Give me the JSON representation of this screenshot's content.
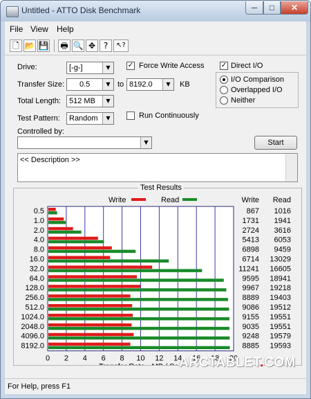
{
  "window": {
    "title": "Untitled - ATTO Disk Benchmark",
    "min_glyph": "─",
    "max_glyph": "□",
    "close_glyph": "✕"
  },
  "menu": {
    "items": [
      "File",
      "View",
      "Help"
    ]
  },
  "toolbar": {
    "icons": [
      {
        "name": "new-file-icon",
        "glyph": "🗋"
      },
      {
        "name": "open-folder-icon",
        "glyph": "📂"
      },
      {
        "name": "save-icon",
        "glyph": "💾"
      },
      {
        "name": "print-icon",
        "glyph": "🖶"
      },
      {
        "name": "print-preview-icon",
        "glyph": "🔍"
      },
      {
        "name": "move-icon",
        "glyph": "✥"
      },
      {
        "name": "help-icon",
        "glyph": "?"
      },
      {
        "name": "context-help-icon",
        "glyph": "↖?"
      }
    ]
  },
  "form": {
    "drive_label": "Drive:",
    "drive_value": "[-g-]",
    "transfer_label": "Transfer Size:",
    "transfer_from": "0.5",
    "to_label": "to",
    "transfer_to": "8192.0",
    "kb_label": "KB",
    "length_label": "Total Length:",
    "length_value": "512 MB",
    "pattern_label": "Test Pattern:",
    "pattern_value": "Random",
    "force_write_label": "Force Write Access",
    "force_write_checked": true,
    "run_cont_label": "Run Continuously",
    "run_cont_checked": false,
    "direct_io_label": "Direct I/O",
    "direct_io_checked": true,
    "io_comparison_label": "I/O Comparison",
    "overlapped_io_label": "Overlapped I/O",
    "neither_label": "Neither",
    "selected_radio": "io_comparison",
    "controlled_by_label": "Controlled by:",
    "controlled_by_value": "",
    "start_label": "Start",
    "description_text": "<< Description >>"
  },
  "chart_data": {
    "type": "bar",
    "title": "Test Results",
    "xlabel": "Transfer Rate - MB / Sec",
    "xlim": [
      0,
      20
    ],
    "xticks": [
      "0",
      "2",
      "4",
      "6",
      "8",
      "10",
      "12",
      "14",
      "16",
      "18",
      "20"
    ],
    "categories": [
      "0.5",
      "1.0",
      "2.0",
      "4.0",
      "8.0",
      "16.0",
      "32.0",
      "64.0",
      "128.0",
      "256.0",
      "512.0",
      "1024.0",
      "2048.0",
      "4096.0",
      "8192.0"
    ],
    "series": [
      {
        "name": "Write",
        "color": "#e01b1b",
        "values": [
          0.867,
          1.731,
          2.724,
          5.413,
          6.898,
          6.714,
          11.241,
          9.595,
          9.967,
          8.889,
          9.086,
          9.155,
          9.035,
          9.248,
          8.885
        ]
      },
      {
        "name": "Read",
        "color": "#1a8a2a",
        "values": [
          1.016,
          1.941,
          3.616,
          6.053,
          9.459,
          13.029,
          16.605,
          18.941,
          19.218,
          19.403,
          19.512,
          19.551,
          19.551,
          19.579,
          19.593
        ]
      }
    ],
    "write_header": "Write",
    "read_header": "Read",
    "write_table": [
      "867",
      "1731",
      "2724",
      "5413",
      "6898",
      "6714",
      "11241",
      "9595",
      "9967",
      "8889",
      "9086",
      "9155",
      "9035",
      "9248",
      "8885"
    ],
    "read_table": [
      "1016",
      "1941",
      "3616",
      "6053",
      "9459",
      "13029",
      "16605",
      "18941",
      "19218",
      "19403",
      "19512",
      "19551",
      "19551",
      "19579",
      "19593"
    ],
    "grid": true,
    "legend_position": "top"
  },
  "status": {
    "text": "For Help, press F1"
  },
  "watermark": {
    "text_main": "ARCTABLET",
    "text_dot": ".",
    "text_tld": "COM"
  }
}
